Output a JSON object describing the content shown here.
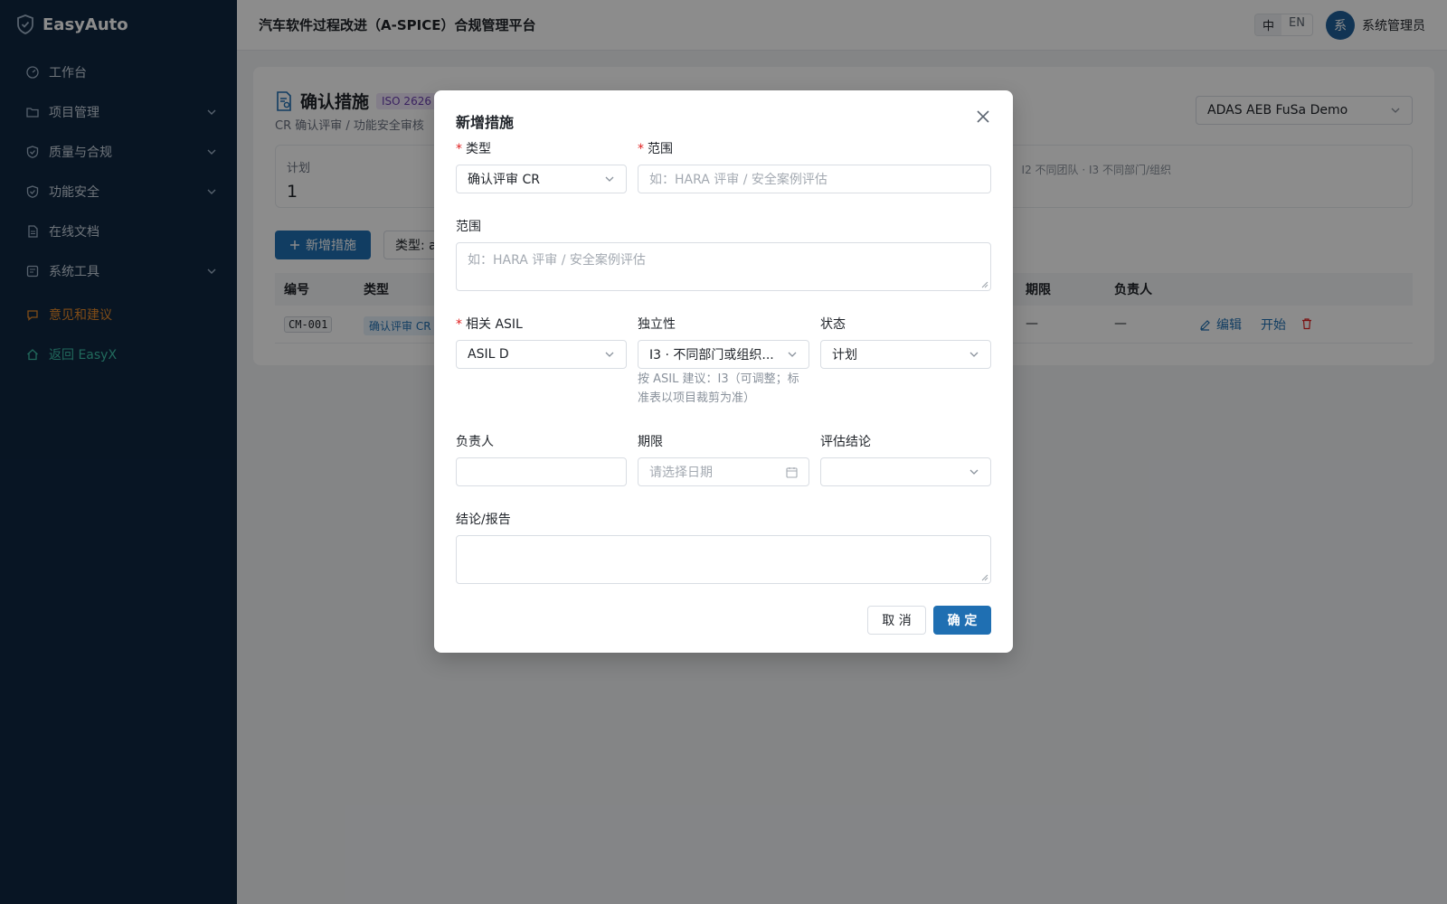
{
  "brand": {
    "name": "EasyAuto"
  },
  "sidebar": {
    "items": [
      {
        "label": "工作台",
        "icon": "dashboard-icon",
        "expandable": false
      },
      {
        "label": "项目管理",
        "icon": "folder-icon",
        "expandable": true
      },
      {
        "label": "质量与合规",
        "icon": "shield-check-icon",
        "expandable": true
      },
      {
        "label": "功能安全",
        "icon": "shield-check-icon",
        "expandable": true
      },
      {
        "label": "在线文档",
        "icon": "document-icon",
        "expandable": false
      },
      {
        "label": "系统工具",
        "icon": "tool-icon",
        "expandable": true
      }
    ],
    "feedback": "意见和建议",
    "back": "返回 EasyX"
  },
  "header": {
    "title": "汽车软件过程改进（A-SPICE）合规管理平台",
    "lang_zh": "中",
    "lang_en": "EN",
    "avatar": "系",
    "user": "系统管理员"
  },
  "page": {
    "title": "确认措施",
    "iso_tag": "ISO 2626",
    "subtitle": "CR 确认评审 / 功能安全审核",
    "project": "ADAS AEB FuSa Demo",
    "stat_label": "计划",
    "stat_value": "1",
    "stat_note": "I2 不同团队 · I3 不同部门/组织",
    "add_button": "新增措施",
    "filter": "类型: al",
    "table": {
      "headers": {
        "code": "编号",
        "type": "类型",
        "deadline": "期限",
        "owner": "负责人"
      },
      "row": {
        "code": "CM-001",
        "type": "确认评审 CR",
        "deadline": "—",
        "owner": "—",
        "edit": "编辑",
        "start": "开始"
      }
    }
  },
  "modal": {
    "title": "新增措施",
    "type_label": "类型",
    "type_value": "确认评审 CR",
    "scope_label": "范围",
    "scope_placeholder": "如：HARA 评审 / 安全案例评估",
    "scope2_label": "范围",
    "scope2_placeholder": "如：HARA 评审 / 安全案例评估",
    "asil_label": "相关 ASIL",
    "asil_value": "ASIL D",
    "independence_label": "独立性",
    "independence_value": "I3 · 不同部门或组织...",
    "independence_hint": "按 ASIL 建议：I3（可调整；标准表以项目裁剪为准）",
    "status_label": "状态",
    "status_value": "计划",
    "owner_label": "负责人",
    "deadline_label": "期限",
    "deadline_placeholder": "请选择日期",
    "verdict_label": "评估结论",
    "report_label": "结论/报告",
    "cancel": "取 消",
    "ok": "确 定"
  },
  "colors": {
    "sidebar": "#0f2741",
    "primary": "#1f6fb2",
    "feedback": "#e98b2a",
    "back": "#3cc0a8",
    "required": "#e02020"
  }
}
